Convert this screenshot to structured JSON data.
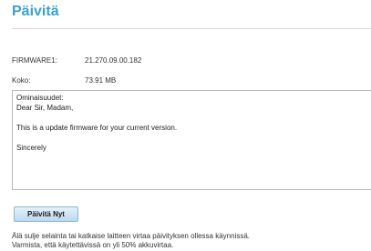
{
  "header": {
    "title": "Päivitä"
  },
  "firmware_info": {
    "firmware_label": "FIRMWARE1:",
    "firmware_value": "21.270.09.00.182",
    "size_label": "Koko:",
    "size_value": "73.91 MB"
  },
  "release_notes": {
    "heading": "Ominaisuudet:",
    "greeting": "Dear Sir, Madam,",
    "body": "This is a update firmware for your current version.",
    "closing": "Sincerely"
  },
  "actions": {
    "update_button_label": "Päivitä Nyt"
  },
  "warnings": {
    "line1": "Älä sulje selainta tai katkaise laitteen virtaa päivityksen ollessa käynnissä.",
    "line2": "Varmista, että käytettävissä on yli 50% akkuvirtaa."
  },
  "colors": {
    "title": "#3aa0d4",
    "button_top": "#e4f1fb",
    "button_bottom": "#bcd9f0"
  }
}
